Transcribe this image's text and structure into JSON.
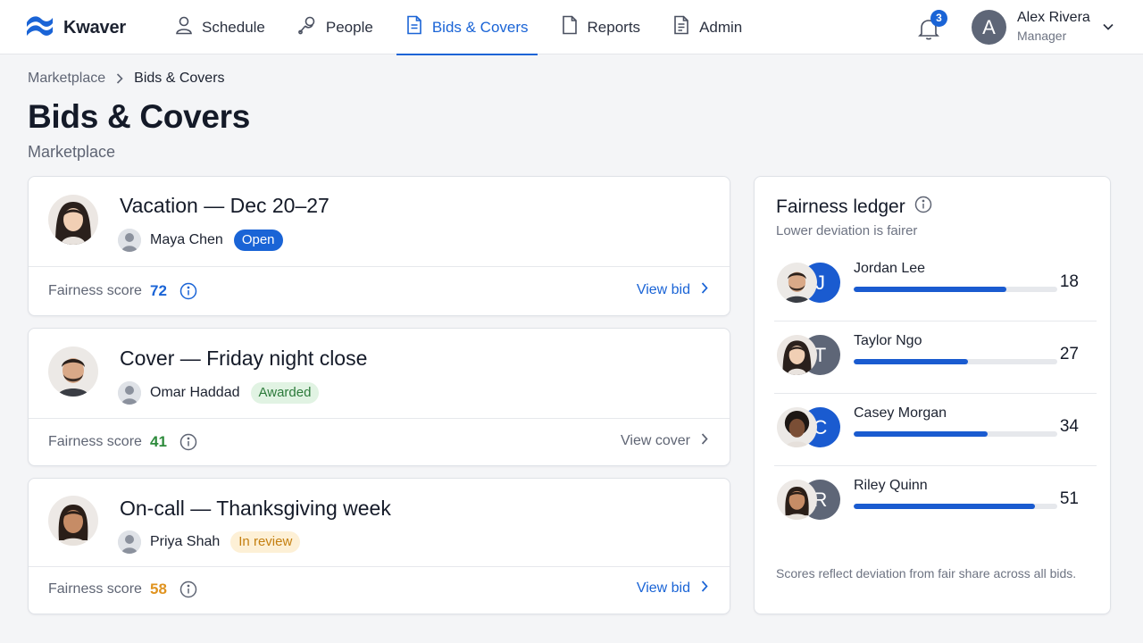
{
  "app": {
    "name": "Kwaver"
  },
  "nav": {
    "items": [
      {
        "label": "Schedule",
        "icon": "user-icon",
        "active": false
      },
      {
        "label": "People",
        "icon": "people-icon",
        "active": false
      },
      {
        "label": "Bids & Covers",
        "icon": "document-icon",
        "active": true
      },
      {
        "label": "Reports",
        "icon": "document-icon",
        "active": false
      },
      {
        "label": "Admin",
        "icon": "document-lines-icon",
        "active": false
      }
    ]
  },
  "notifications": {
    "count": "3"
  },
  "user": {
    "initial": "A",
    "name": "Alex Rivera",
    "role": "Manager"
  },
  "breadcrumb": {
    "parent": "Marketplace",
    "current": "Bids & Covers"
  },
  "page": {
    "title": "Bids & Covers",
    "subtitle": "Marketplace"
  },
  "cards": [
    {
      "title": "Vacation — Dec 20–27",
      "owner": "Maya Chen",
      "status": "Open",
      "score_label": "Fairness score",
      "score": "72",
      "score_color": "#1a64d6",
      "action": "View bid",
      "action_color": "#1a64d6"
    },
    {
      "title": "Cover — Friday night close",
      "owner": "Omar Haddad",
      "status": "Awarded",
      "score_label": "Fairness score",
      "score": "41",
      "score_color": "#2e8b3c",
      "action": "View cover",
      "action_color": "#5f6574"
    },
    {
      "title": "On-call — Thanksgiving week",
      "owner": "Priya Shah",
      "status": "In review",
      "score_label": "Fairness score",
      "score": "58",
      "score_color": "#e0931f",
      "action": "View bid",
      "action_color": "#1a64d6"
    }
  ],
  "ledger": {
    "title": "Fairness ledger",
    "subtitle": "Lower deviation is fairer",
    "footnote": "Scores reflect deviation from fair share across all bids.",
    "rows": [
      {
        "name": "Jordan Lee",
        "initial": "J",
        "initial_color": "#1a5bd0",
        "score": "18",
        "bar_fraction": 0.75
      },
      {
        "name": "Taylor Ngo",
        "initial": "T",
        "initial_color": "#5e6677",
        "score": "27",
        "bar_fraction": 0.56
      },
      {
        "name": "Casey Morgan",
        "initial": "C",
        "initial_color": "#1a5bd0",
        "score": "34",
        "bar_fraction": 0.66
      },
      {
        "name": "Riley Quinn",
        "initial": "R",
        "initial_color": "#5e6677",
        "score": "51",
        "bar_fraction": 0.89
      }
    ]
  },
  "colors": {
    "accent": "#1a64d6",
    "open": "#1a64d6",
    "awarded": "#2c7a3a",
    "review": "#c47f10"
  }
}
